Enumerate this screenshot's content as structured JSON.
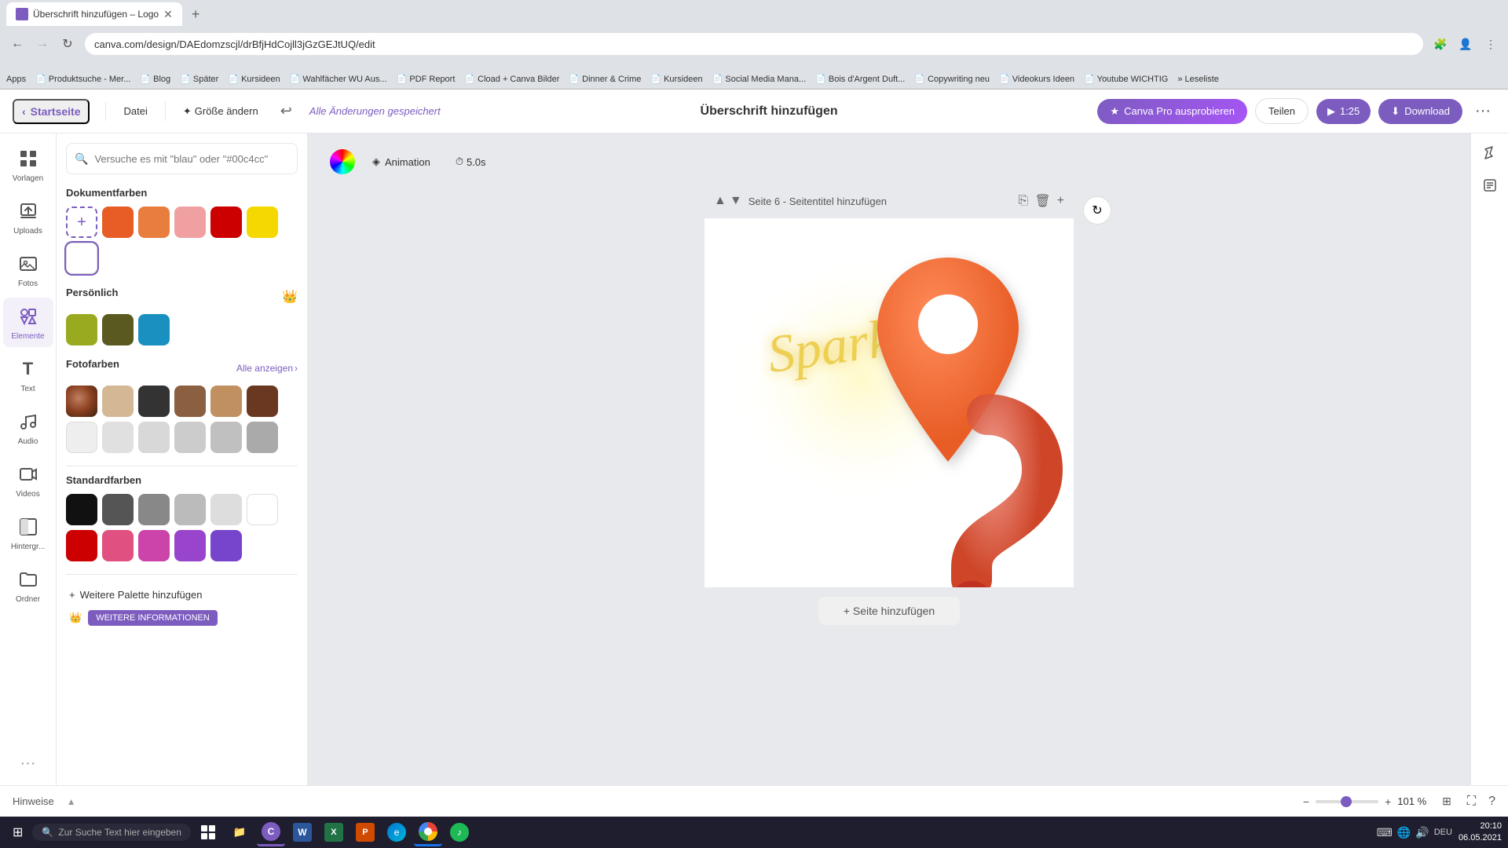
{
  "browser": {
    "tab_title": "Überschrift hinzufügen – Logo",
    "address": "canva.com/design/DAEdomzscjl/drBfjHdCojll3jGzGEJtUQ/edit",
    "bookmarks": [
      "Apps",
      "Produktsuche - Mer...",
      "Blog",
      "Später",
      "Kursideen",
      "Wahlfächer WU Aus...",
      "PDF Report",
      "Cload + Canva Bilder",
      "Dinner & Crime",
      "Kursideen",
      "Social Media Mana...",
      "Bois d'Argent Duft...",
      "Copywriting neu",
      "Videokurs Ideen",
      "Youtube WICHTIG",
      "Leseliste"
    ]
  },
  "topnav": {
    "home_label": "Startseite",
    "file_label": "Datei",
    "size_label": "Größe ändern",
    "saved_label": "Alle Änderungen gespeichert",
    "title": "Überschrift hinzufügen",
    "canva_pro_label": "Canva Pro ausprobieren",
    "share_label": "Teilen",
    "play_time": "1:25",
    "download_label": "Download"
  },
  "left_sidebar_icons": [
    {
      "id": "vorlagen",
      "label": "Vorlagen",
      "icon": "⊞"
    },
    {
      "id": "uploads",
      "label": "Uploads",
      "icon": "↑"
    },
    {
      "id": "fotos",
      "label": "Fotos",
      "icon": "🖼"
    },
    {
      "id": "elemente",
      "label": "Elemente",
      "icon": "✦"
    },
    {
      "id": "text",
      "label": "Text",
      "icon": "T"
    },
    {
      "id": "audio",
      "label": "Audio",
      "icon": "♪"
    },
    {
      "id": "videos",
      "label": "Videos",
      "icon": "▶"
    },
    {
      "id": "hintergruende",
      "label": "Hintergr...",
      "icon": "◧"
    },
    {
      "id": "ordner",
      "label": "Ordner",
      "icon": "📁"
    }
  ],
  "color_panel": {
    "search_placeholder": "Versuche es mit \"blau\" oder \"#00c4cc\"",
    "doc_colors_title": "Dokumentfarben",
    "doc_colors": [
      {
        "id": "add",
        "type": "add"
      },
      {
        "id": "orange-red",
        "color": "#e85d26"
      },
      {
        "id": "orange",
        "color": "#e87d3e"
      },
      {
        "id": "pink",
        "color": "#f0a0a0"
      },
      {
        "id": "red",
        "color": "#cc0000"
      },
      {
        "id": "yellow",
        "color": "#f5d800"
      },
      {
        "id": "white",
        "color": "#ffffff"
      }
    ],
    "personal_title": "Persönlich",
    "personal_colors": [
      {
        "id": "olive-yellow",
        "color": "#9aaa20"
      },
      {
        "id": "dark-olive",
        "color": "#5a5a20"
      },
      {
        "id": "teal-blue",
        "color": "#1a90c0"
      }
    ],
    "photo_title": "Fotofarben",
    "see_all_label": "Alle anzeigen",
    "photo_colors_row1": [
      {
        "id": "photo-thumb",
        "type": "photo"
      },
      {
        "id": "beige",
        "color": "#d4b896"
      },
      {
        "id": "dark-gray",
        "color": "#333333"
      },
      {
        "id": "medium-brown",
        "color": "#8a6040"
      },
      {
        "id": "tan",
        "color": "#c09060"
      },
      {
        "id": "dark-brown",
        "color": "#6a3820"
      }
    ],
    "photo_colors_row2": [
      {
        "id": "off-white",
        "color": "#eeeeee"
      },
      {
        "id": "light-gray1",
        "color": "#e0e0e0"
      },
      {
        "id": "light-gray2",
        "color": "#d8d8d8"
      },
      {
        "id": "light-gray3",
        "color": "#cccccc"
      },
      {
        "id": "light-gray4",
        "color": "#c0c0c0"
      },
      {
        "id": "medium-gray",
        "color": "#aaaaaa"
      }
    ],
    "standard_title": "Standardfarben",
    "standard_row1": [
      {
        "id": "black",
        "color": "#111111"
      },
      {
        "id": "dark-gray-s",
        "color": "#555555"
      },
      {
        "id": "gray-s",
        "color": "#888888"
      },
      {
        "id": "light-gray-s",
        "color": "#bbbbbb"
      },
      {
        "id": "lighter-gray-s",
        "color": "#dddddd"
      },
      {
        "id": "white-s",
        "color": "#ffffff"
      }
    ],
    "standard_row2": [
      {
        "id": "std-red",
        "color": "#cc0000"
      },
      {
        "id": "std-pink",
        "color": "#e05080"
      },
      {
        "id": "std-magenta",
        "color": "#cc44aa"
      },
      {
        "id": "std-violet",
        "color": "#9944cc"
      },
      {
        "id": "std-purple",
        "color": "#7744cc"
      }
    ],
    "add_palette_label": "Weitere Palette hinzufügen",
    "more_info_label": "WEITERE INFORMATIONEN"
  },
  "canvas": {
    "animation_label": "Animation",
    "duration_label": "5.0s",
    "page_title": "Seite 6 - Seitentitel hinzufügen",
    "add_page_label": "+ Seite hinzufügen",
    "refresh_icon": "↻"
  },
  "bottom_bar": {
    "hints_label": "Hinweise",
    "zoom_value": 101,
    "zoom_display": "101 %"
  },
  "taskbar": {
    "search_placeholder": "Zur Suche Text hier eingeben",
    "time": "20:10",
    "date": "06.05.2021",
    "apps": [
      "⊞",
      "🔍",
      "📁",
      "📋",
      "W",
      "X",
      "P",
      "⚡",
      "🎵"
    ]
  }
}
